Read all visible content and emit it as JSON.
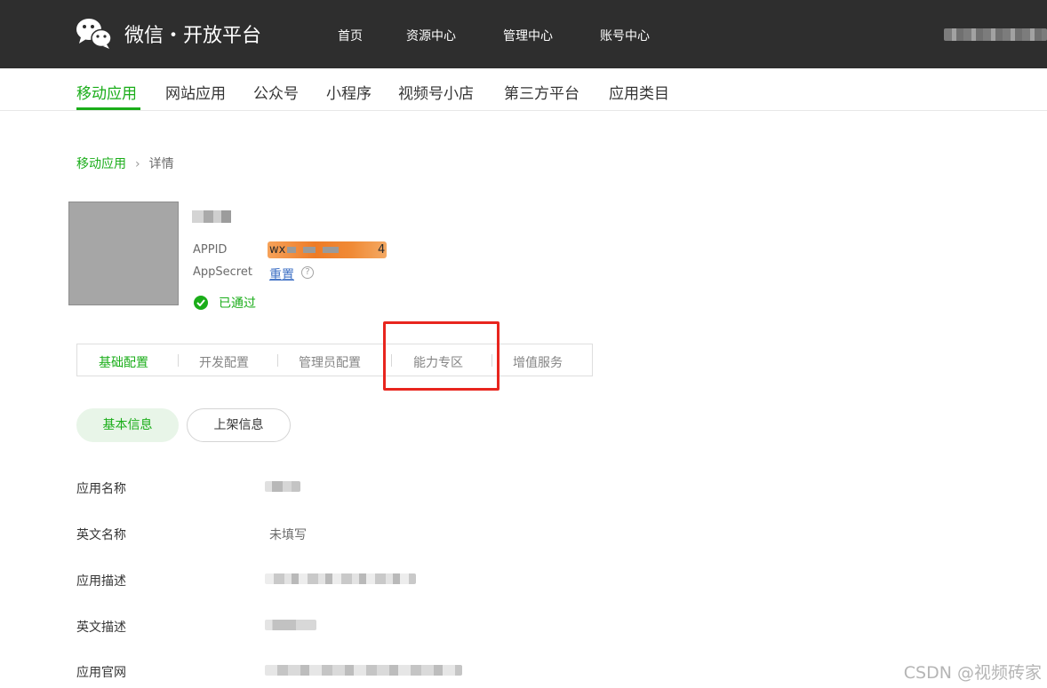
{
  "header": {
    "brand": "微信・开放平台",
    "nav": [
      "首页",
      "资源中心",
      "管理中心",
      "账号中心"
    ]
  },
  "categories": {
    "items": [
      "移动应用",
      "网站应用",
      "公众号",
      "小程序",
      "视频号小店",
      "第三方平台",
      "应用类目"
    ],
    "active": "移动应用"
  },
  "breadcrumb": {
    "parent": "移动应用",
    "separator": "›",
    "current": "详情"
  },
  "app": {
    "appid_label": "APPID",
    "appid_prefix": "wx",
    "appid_suffix": "4",
    "appsecret_label": "AppSecret",
    "reset_label": "重置",
    "help_icon": "?",
    "status": "已通过"
  },
  "config_tabs": {
    "items": [
      "基础配置",
      "开发配置",
      "管理员配置",
      "能力专区",
      "增值服务"
    ],
    "active": "基础配置",
    "highlighted": "能力专区"
  },
  "info_tabs": {
    "items": [
      "基本信息",
      "上架信息"
    ],
    "active": "基本信息"
  },
  "fields": {
    "rows": [
      {
        "label": "应用名称",
        "value": ""
      },
      {
        "label": "英文名称",
        "value": "未填写"
      },
      {
        "label": "应用描述",
        "value": ""
      },
      {
        "label": "英文描述",
        "value": ""
      },
      {
        "label": "应用官网",
        "value": ""
      }
    ]
  },
  "watermark": "CSDN @视频砖家",
  "colors": {
    "accent": "#1aad19",
    "topbar": "#2e2e2e",
    "highlight": "#e8251e",
    "link": "#3d6fc4"
  }
}
